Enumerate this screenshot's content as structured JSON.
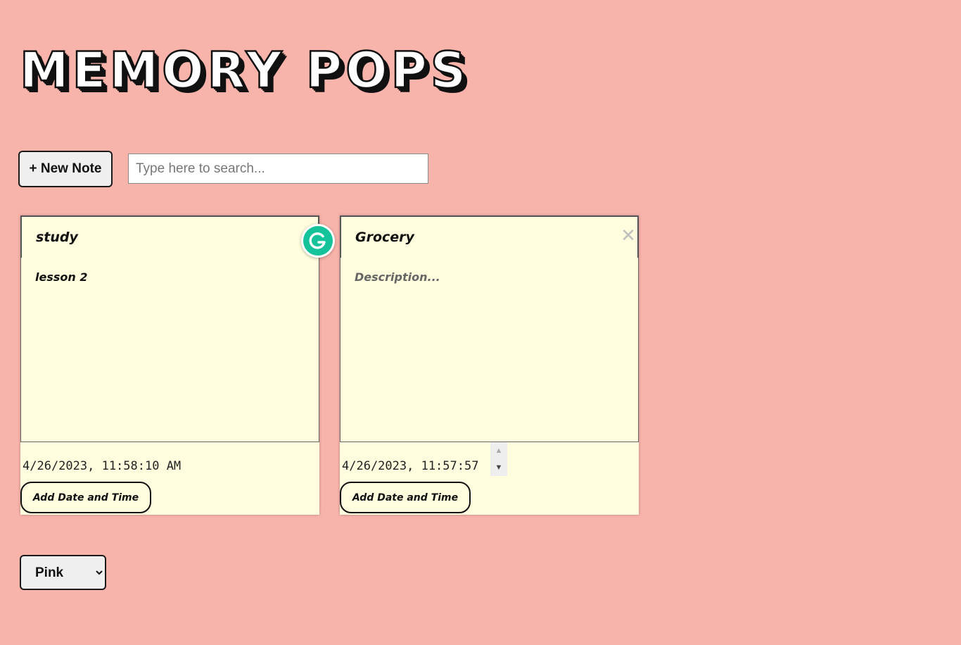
{
  "app": {
    "title": "MEMORY POPS"
  },
  "toolbar": {
    "new_note_label": "+ New Note",
    "search_placeholder": "Type here to search...",
    "search_value": ""
  },
  "notes": [
    {
      "title": "study",
      "description": "lesson 2",
      "description_placeholder": "Description...",
      "datetime": "4/26/2023, 11:58:10 AM",
      "add_datetime_label": "Add Date and Time"
    },
    {
      "title": "Grocery",
      "description": "",
      "description_placeholder": "Description...",
      "datetime": "4/26/2023, 11:57:57",
      "add_datetime_label": "Add Date and Time",
      "close_label": "✕"
    }
  ],
  "theme_select": {
    "selected": "Pink",
    "options": [
      "Pink"
    ]
  },
  "icons": {
    "grammarly": "grammarly-icon",
    "close": "close-icon",
    "spin_up": "chevron-up-icon",
    "spin_down": "chevron-down-icon"
  },
  "colors": {
    "background": "#f8b4ab",
    "note_background": "#fffddd",
    "grammarly_green": "#15c39a"
  }
}
